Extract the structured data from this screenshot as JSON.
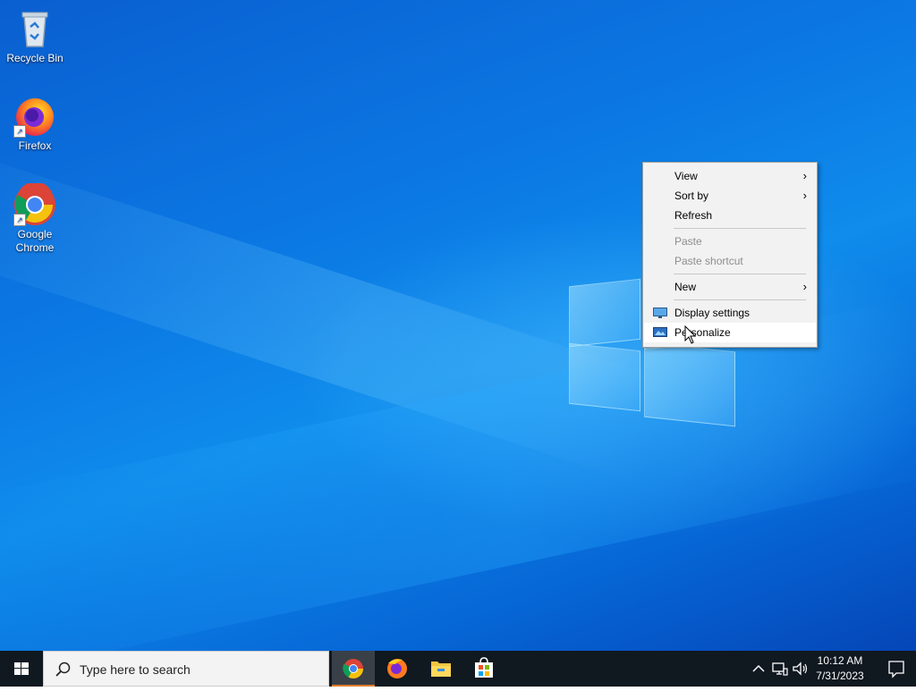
{
  "desktop": {
    "icons": [
      {
        "label": "Recycle Bin",
        "icon": "recycle-bin-icon"
      },
      {
        "label": "Firefox",
        "icon": "firefox-icon"
      },
      {
        "label": "Google Chrome",
        "icon": "chrome-icon"
      }
    ]
  },
  "context_menu": {
    "items": [
      {
        "label": "View",
        "submenu": true,
        "enabled": true
      },
      {
        "label": "Sort by",
        "submenu": true,
        "enabled": true
      },
      {
        "label": "Refresh",
        "submenu": false,
        "enabled": true
      },
      {
        "label": "Paste",
        "submenu": false,
        "enabled": false
      },
      {
        "label": "Paste shortcut",
        "submenu": false,
        "enabled": false
      },
      {
        "label": "New",
        "submenu": true,
        "enabled": true
      },
      {
        "label": "Display settings",
        "icon": "display-settings-icon",
        "enabled": true
      },
      {
        "label": "Personalize",
        "icon": "personalize-icon",
        "enabled": true,
        "hovered": true
      }
    ],
    "chevron": "›"
  },
  "taskbar": {
    "search_placeholder": "Type here to search",
    "apps": [
      "chrome-icon",
      "firefox-icon",
      "file-explorer-icon",
      "microsoft-store-icon"
    ],
    "active_app": "chrome-icon",
    "clock": {
      "time": "10:12 AM",
      "date": "7/31/2023"
    },
    "tray": [
      "show-hidden-icons-chevron",
      "network-icon",
      "volume-icon"
    ]
  },
  "colors": {
    "menu_bg": "#f2f2f2",
    "taskbar_bg": "#101820",
    "active_underline": "#e07b2b"
  }
}
